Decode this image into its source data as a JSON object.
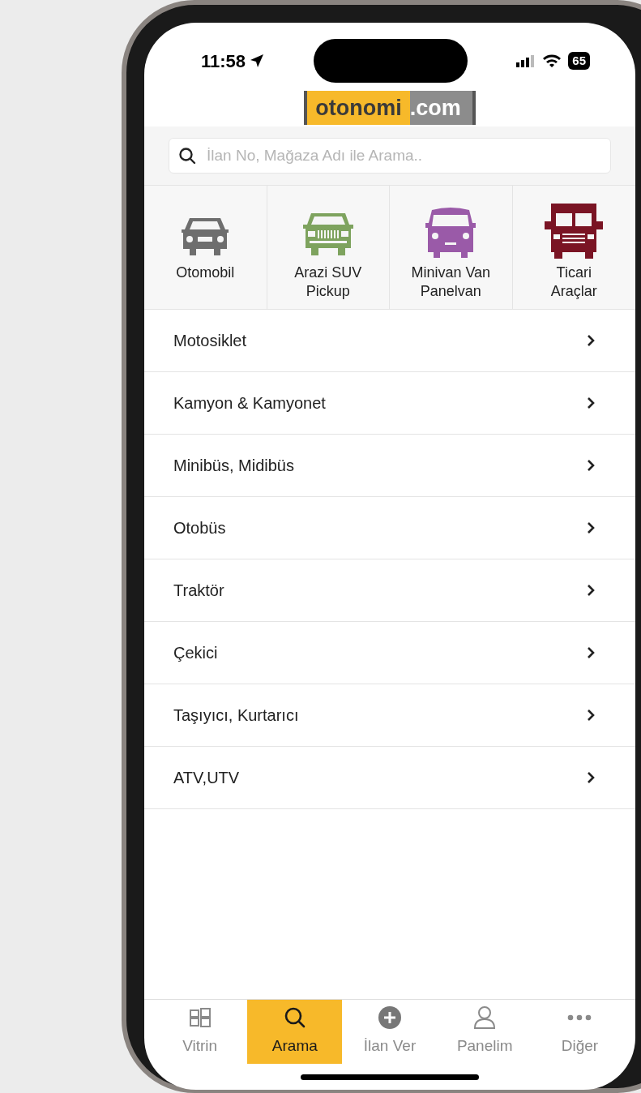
{
  "status_bar": {
    "time": "11:58",
    "battery": "65"
  },
  "logo": {
    "brand": "otonomi",
    "domain": ".com"
  },
  "search": {
    "placeholder": "İlan No, Mağaza Adı ile Arama.."
  },
  "categories": [
    {
      "label": "Otomobil",
      "kind": "car",
      "color": "#6e6e6e"
    },
    {
      "label": "Arazi SUV\nPickup",
      "kind": "suv",
      "color": "#7ea35e"
    },
    {
      "label": "Minivan Van\nPanelvan",
      "kind": "van",
      "color": "#9a5aa8"
    },
    {
      "label": "Ticari\nAraçlar",
      "kind": "truck",
      "color": "#7a1424"
    }
  ],
  "list": [
    "Motosiklet",
    "Kamyon & Kamyonet",
    "Minibüs, Midibüs",
    "Otobüs",
    "Traktör",
    "Çekici",
    "Taşıyıcı, Kurtarıcı",
    "ATV,UTV"
  ],
  "tabs": [
    {
      "label": "Vitrin",
      "kind": "grid",
      "selected": false
    },
    {
      "label": "Arama",
      "kind": "search",
      "selected": true
    },
    {
      "label": "İlan Ver",
      "kind": "plus",
      "selected": false
    },
    {
      "label": "Panelim",
      "kind": "person",
      "selected": false
    },
    {
      "label": "Diğer",
      "kind": "more",
      "selected": false
    }
  ]
}
